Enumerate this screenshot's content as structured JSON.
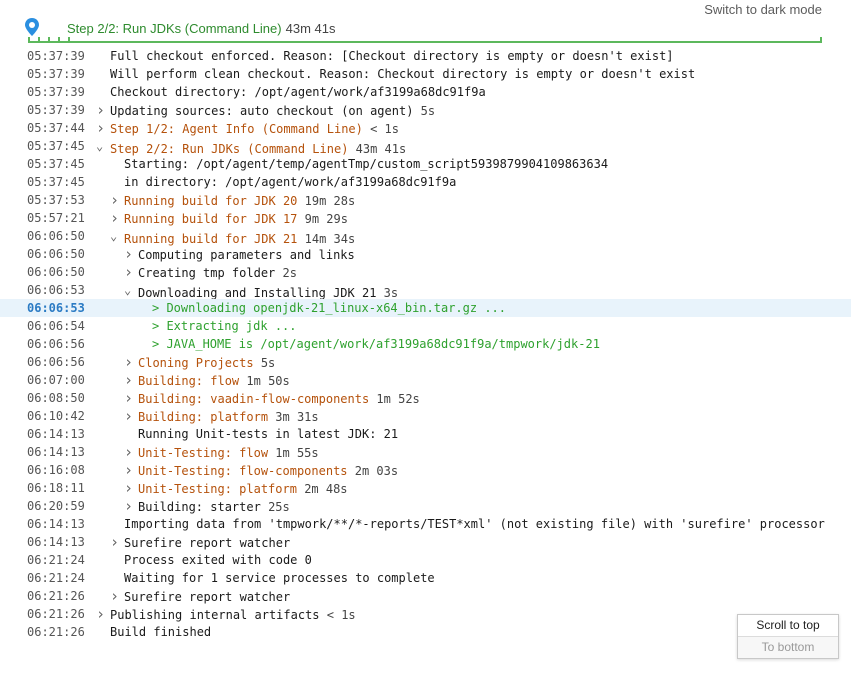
{
  "header": {
    "dark_mode_label": "Switch to dark mode",
    "step_title": "Step 2/2: Run JDKs (Command Line)",
    "step_duration": "43m 41s",
    "accent_color": "#5cb85c"
  },
  "log": [
    {
      "ts": "05:37:39",
      "indent": 0,
      "toggle": "none",
      "text": "Full checkout enforced. Reason: [Checkout directory is empty or doesn't exist]",
      "dur": "",
      "color": "default"
    },
    {
      "ts": "05:37:39",
      "indent": 0,
      "toggle": "none",
      "text": "Will perform clean checkout. Reason: Checkout directory is empty or doesn't exist",
      "dur": "",
      "color": "default"
    },
    {
      "ts": "05:37:39",
      "indent": 0,
      "toggle": "none",
      "text": "Checkout directory: /opt/agent/work/af3199a68dc91f9a",
      "dur": "",
      "color": "default"
    },
    {
      "ts": "05:37:39",
      "indent": 0,
      "toggle": "collapsed",
      "text": "Updating sources: auto checkout (on agent)",
      "dur": "5s",
      "color": "default"
    },
    {
      "ts": "05:37:44",
      "indent": 0,
      "toggle": "collapsed",
      "text": "Step 1/2: Agent Info (Command Line)",
      "dur": "< 1s",
      "color": "orange"
    },
    {
      "ts": "05:37:45",
      "indent": 0,
      "toggle": "expanded",
      "text": "Step 2/2: Run JDKs (Command Line)",
      "dur": "43m 41s",
      "color": "orange"
    },
    {
      "ts": "05:37:45",
      "indent": 1,
      "toggle": "none",
      "text": "Starting: /opt/agent/temp/agentTmp/custom_script5939879904109863634",
      "dur": "",
      "color": "default"
    },
    {
      "ts": "05:37:45",
      "indent": 1,
      "toggle": "none",
      "text": "in directory: /opt/agent/work/af3199a68dc91f9a",
      "dur": "",
      "color": "default"
    },
    {
      "ts": "05:37:53",
      "indent": 1,
      "toggle": "collapsed",
      "text": "Running build for JDK 20",
      "dur": "19m 28s",
      "color": "orange"
    },
    {
      "ts": "05:57:21",
      "indent": 1,
      "toggle": "collapsed",
      "text": "Running build for JDK 17",
      "dur": "9m 29s",
      "color": "orange"
    },
    {
      "ts": "06:06:50",
      "indent": 1,
      "toggle": "expanded",
      "text": "Running build for JDK 21",
      "dur": "14m 34s",
      "color": "orange"
    },
    {
      "ts": "06:06:50",
      "indent": 2,
      "toggle": "collapsed",
      "text": "Computing parameters and links",
      "dur": "",
      "color": "default"
    },
    {
      "ts": "06:06:50",
      "indent": 2,
      "toggle": "collapsed",
      "text": "Creating tmp folder",
      "dur": "2s",
      "color": "default"
    },
    {
      "ts": "06:06:53",
      "indent": 2,
      "toggle": "expanded",
      "text": "Downloading and Installing JDK 21",
      "dur": "3s",
      "color": "default"
    },
    {
      "ts": "06:06:53",
      "indent": 3,
      "toggle": "none",
      "text": "> Downloading openjdk-21_linux-x64_bin.tar.gz ...",
      "dur": "",
      "color": "green",
      "highlight": true
    },
    {
      "ts": "06:06:54",
      "indent": 3,
      "toggle": "none",
      "text": "> Extracting jdk ...",
      "dur": "",
      "color": "green"
    },
    {
      "ts": "06:06:56",
      "indent": 3,
      "toggle": "none",
      "text": "> JAVA_HOME is /opt/agent/work/af3199a68dc91f9a/tmpwork/jdk-21",
      "dur": "",
      "color": "green"
    },
    {
      "ts": "06:06:56",
      "indent": 2,
      "toggle": "collapsed",
      "text": "Cloning Projects",
      "dur": "5s",
      "color": "orange"
    },
    {
      "ts": "06:07:00",
      "indent": 2,
      "toggle": "collapsed",
      "text": "Building: flow",
      "dur": "1m 50s",
      "color": "orange"
    },
    {
      "ts": "06:08:50",
      "indent": 2,
      "toggle": "collapsed",
      "text": "Building: vaadin-flow-components",
      "dur": "1m 52s",
      "color": "orange"
    },
    {
      "ts": "06:10:42",
      "indent": 2,
      "toggle": "collapsed",
      "text": "Building: platform",
      "dur": "3m 31s",
      "color": "orange"
    },
    {
      "ts": "06:14:13",
      "indent": 2,
      "toggle": "none",
      "text": "Running Unit-tests in latest JDK: 21",
      "dur": "",
      "color": "default"
    },
    {
      "ts": "06:14:13",
      "indent": 2,
      "toggle": "collapsed",
      "text": "Unit-Testing: flow",
      "dur": "1m 55s",
      "color": "orange"
    },
    {
      "ts": "06:16:08",
      "indent": 2,
      "toggle": "collapsed",
      "text": "Unit-Testing: flow-components",
      "dur": "2m 03s",
      "color": "orange"
    },
    {
      "ts": "06:18:11",
      "indent": 2,
      "toggle": "collapsed",
      "text": "Unit-Testing: platform",
      "dur": "2m 48s",
      "color": "orange"
    },
    {
      "ts": "06:20:59",
      "indent": 2,
      "toggle": "collapsed",
      "text": "Building: starter",
      "dur": "25s",
      "color": "default"
    },
    {
      "ts": "06:14:13",
      "indent": 1,
      "toggle": "none",
      "text": "Importing data from 'tmpwork/**/*-reports/TEST*xml' (not existing file) with 'surefire' processor",
      "dur": "",
      "color": "default"
    },
    {
      "ts": "06:14:13",
      "indent": 1,
      "toggle": "collapsed",
      "text": "Surefire report watcher",
      "dur": "",
      "color": "default"
    },
    {
      "ts": "06:21:24",
      "indent": 1,
      "toggle": "none",
      "text": "Process exited with code 0",
      "dur": "",
      "color": "default"
    },
    {
      "ts": "06:21:24",
      "indent": 1,
      "toggle": "none",
      "text": "Waiting for 1 service processes to complete",
      "dur": "",
      "color": "default"
    },
    {
      "ts": "06:21:26",
      "indent": 1,
      "toggle": "collapsed",
      "text": "Surefire report watcher",
      "dur": "",
      "color": "default"
    },
    {
      "ts": "06:21:26",
      "indent": 0,
      "toggle": "collapsed",
      "text": "Publishing internal artifacts",
      "dur": "< 1s",
      "color": "default"
    },
    {
      "ts": "06:21:26",
      "indent": 0,
      "toggle": "none",
      "text": "Build finished",
      "dur": "",
      "color": "default"
    }
  ],
  "scroll": {
    "to_top_label": "Scroll to top",
    "to_bottom_label": "To bottom"
  }
}
